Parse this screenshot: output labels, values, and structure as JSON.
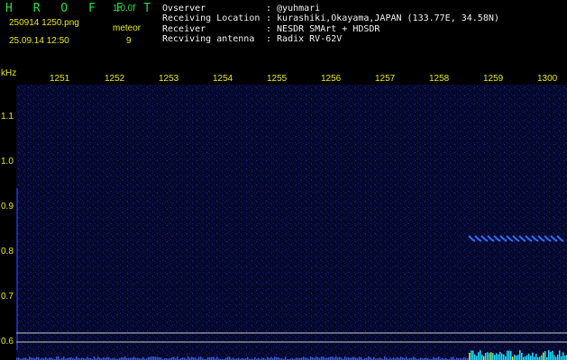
{
  "header": {
    "app_title": "H R O F F T",
    "version": "1.0.0f",
    "filename": "250914 1250.png",
    "datetime": "25.09.14 12:50",
    "meteor_label": "meteor",
    "meteor_count": "9"
  },
  "info": [
    {
      "label": "Ovserver",
      "value": ": @yuhmari"
    },
    {
      "label": "Receiving Location",
      "value": ": kurashiki,Okayama,JAPAN (133.77E, 34.58N)"
    },
    {
      "label": "Receiver",
      "value": ": NESDR SMArt + HDSDR"
    },
    {
      "label": "Recviving antenna",
      "value": ": Radix RV-62V"
    }
  ],
  "time_axis": {
    "ticks": [
      "1251",
      "1252",
      "1253",
      "1254",
      "1255",
      "1256",
      "1257",
      "1258",
      "1259",
      "1300"
    ]
  },
  "freq_axis": {
    "unit": "kHz",
    "ticks": [
      "1.1",
      "1.0",
      "0.9",
      "0.8",
      "0.7",
      "0.6"
    ]
  },
  "colors": {
    "background": "#000000",
    "spectrogram_bg": "#05082a",
    "title_green": "#22dd44",
    "label_yellow": "#e8e80a",
    "text_white": "#f2f2f2",
    "signal_blue": "#2a6fff",
    "signal_cyan": "#20e0ff",
    "guide_line": "#c8c8c8"
  },
  "signals": [
    {
      "type": "meteor-echo-trail",
      "time_start": "1258.7",
      "time_end": "1300",
      "freq_khz": 0.825
    }
  ]
}
